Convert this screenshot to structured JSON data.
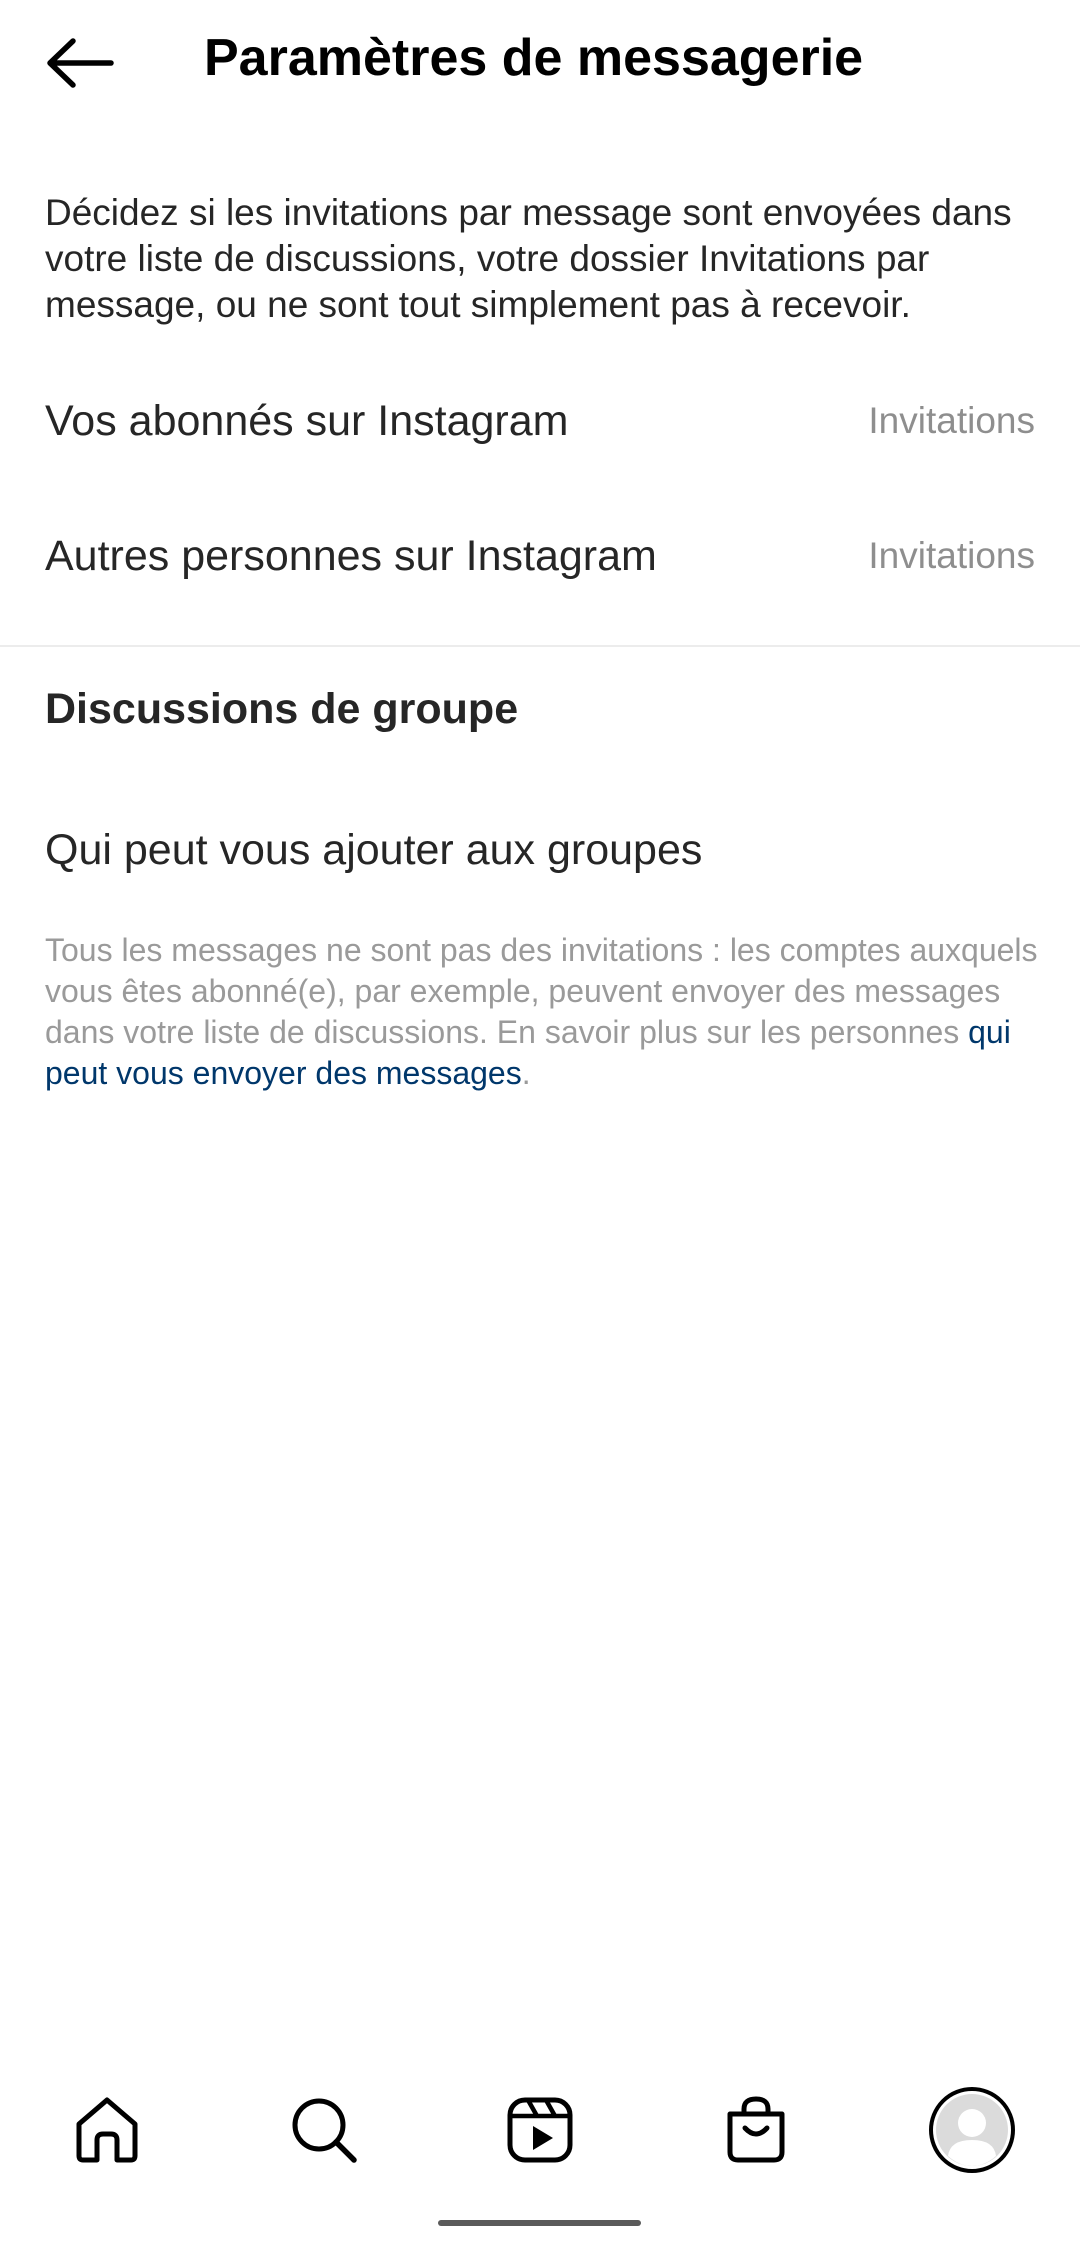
{
  "header": {
    "title": "Paramètres de messagerie"
  },
  "intro": {
    "text": "Décidez si les invitations par message sont envoyées dans votre liste de discussions, votre dossier Invitations par message, ou ne sont tout simplement pas à recevoir."
  },
  "settings": [
    {
      "label": "Vos abonnés sur Instagram",
      "value": "Invitations"
    },
    {
      "label": "Autres personnes sur Instagram",
      "value": "Invitations"
    }
  ],
  "group_section": {
    "title": "Discussions de groupe",
    "row_label": "Qui peut vous ajouter aux groupes"
  },
  "footnote": {
    "text": "Tous les messages ne sont pas des invitations : les comptes auxquels vous êtes abonné(e), par exemple, peuvent envoyer des messages dans votre liste de discussions. En savoir plus sur les personnes ",
    "link": "qui peut vous envoyer des messages",
    "suffix": "."
  },
  "tabbar": {
    "icons": [
      "home-icon",
      "search-icon",
      "reels-icon",
      "shop-icon",
      "profile-avatar-icon"
    ]
  },
  "colors": {
    "text_primary": "#262626",
    "text_secondary": "#8e8e8e",
    "link": "#00376b",
    "divider": "#ececec"
  }
}
